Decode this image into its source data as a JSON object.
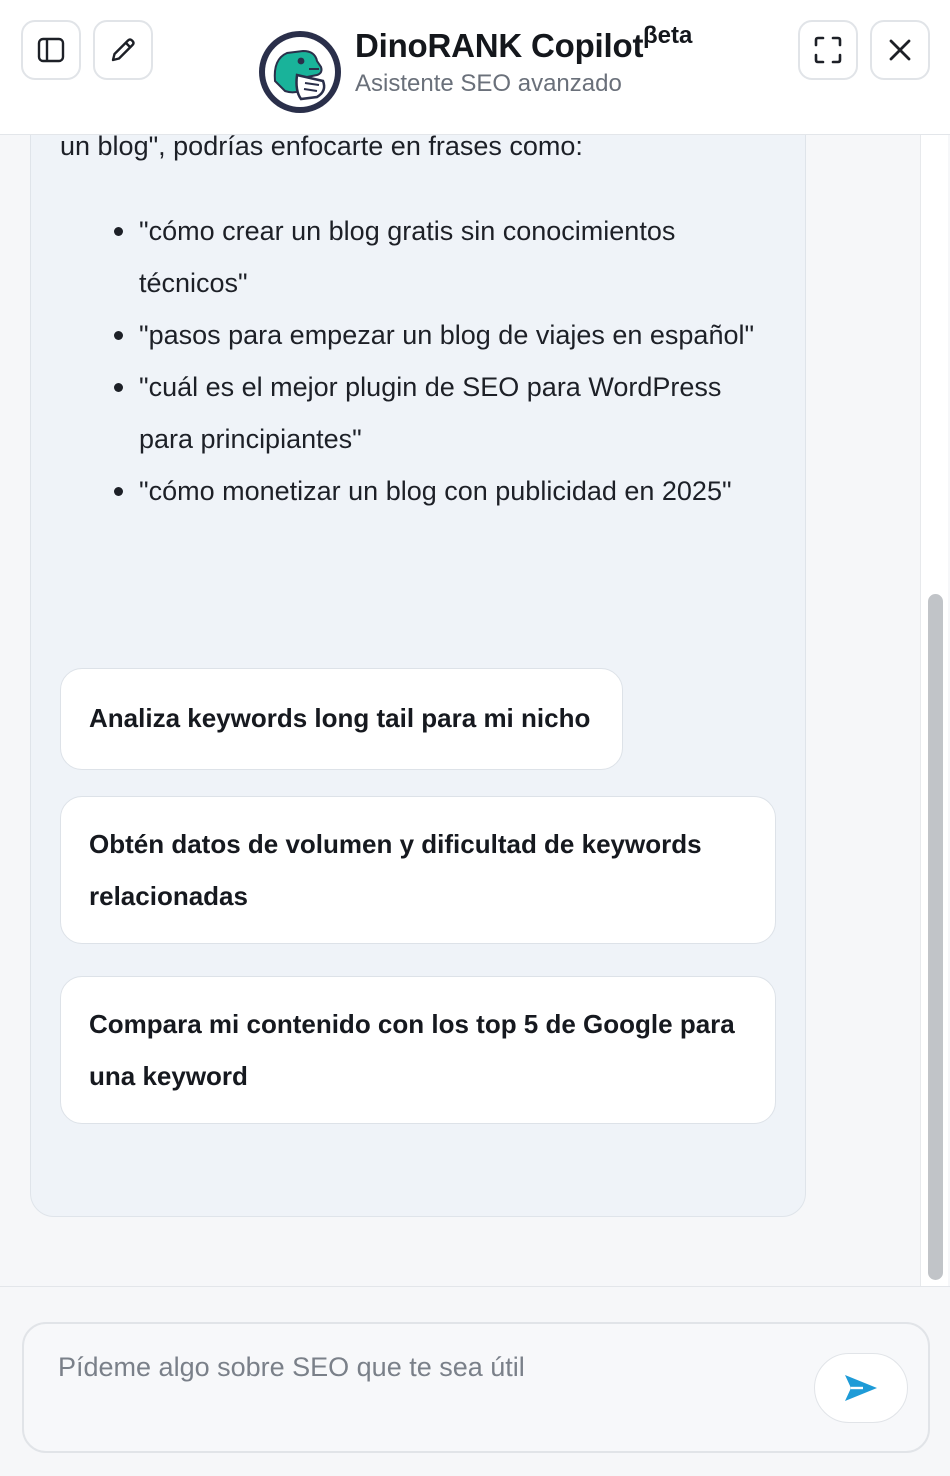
{
  "header": {
    "title": "DinoRANK Copilot",
    "beta_badge": "βeta",
    "subtitle": "Asistente SEO avanzado",
    "buttons": {
      "toggle_sidebar_icon": "sidebar-panel-icon",
      "new_chat_icon": "pencil-icon",
      "expand_icon": "fullscreen-icon",
      "close_icon": "close-icon"
    }
  },
  "message": {
    "intro_fragment": "un blog\", podrías enfocarte en frases como:",
    "bullets": [
      "\"cómo crear un blog gratis sin conocimientos técnicos\"",
      "\"pasos para empezar un blog de viajes en español\"",
      "\"cuál es el mejor plugin de SEO para WordPress para principiantes\"",
      "\"cómo monetizar un blog con publicidad en 2025\""
    ]
  },
  "suggestions": [
    "Analiza keywords long tail para mi nicho",
    "Obtén datos de volumen y dificultad de keywords relacionadas",
    "Compara mi contenido con los top 5 de Google para una keyword"
  ],
  "composer": {
    "placeholder": "Pídeme algo sobre SEO que te sea útil",
    "value": "",
    "send_icon": "send-arrow-icon"
  },
  "colors": {
    "accent_send": "#1e9bd7",
    "logo_teal": "#19b39a",
    "logo_navy": "#2a2f4a",
    "bubble_bg": "#eff3f8"
  }
}
